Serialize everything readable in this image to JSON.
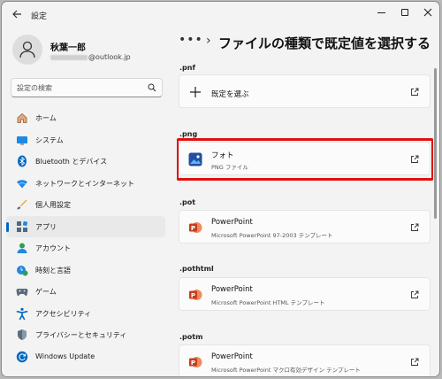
{
  "window": {
    "app_title": "設定"
  },
  "account": {
    "name": "秋葉一郎",
    "email_suffix": "@outlook.jp"
  },
  "search": {
    "placeholder": "設定の検索"
  },
  "sidebar": {
    "items": [
      {
        "label": "ホーム",
        "icon": "home-icon"
      },
      {
        "label": "システム",
        "icon": "system-icon"
      },
      {
        "label": "Bluetooth とデバイス",
        "icon": "bluetooth-icon"
      },
      {
        "label": "ネットワークとインターネット",
        "icon": "network-icon"
      },
      {
        "label": "個人用設定",
        "icon": "personalization-icon"
      },
      {
        "label": "アプリ",
        "icon": "apps-icon",
        "selected": true
      },
      {
        "label": "アカウント",
        "icon": "account-icon"
      },
      {
        "label": "時刻と言語",
        "icon": "time-language-icon"
      },
      {
        "label": "ゲーム",
        "icon": "gaming-icon"
      },
      {
        "label": "アクセシビリティ",
        "icon": "accessibility-icon"
      },
      {
        "label": "プライバシーとセキュリティ",
        "icon": "privacy-icon"
      },
      {
        "label": "Windows Update",
        "icon": "windows-update-icon"
      }
    ]
  },
  "header": {
    "breadcrumb_dots": "•••",
    "chevron": "›",
    "title": "ファイルの種類で既定値を選択する"
  },
  "main": {
    "sections": [
      {
        "ext": ".pnf",
        "app": "既定を選ぶ",
        "desc": "",
        "icon": "plus-icon"
      },
      {
        "ext": ".png",
        "app": "フォト",
        "desc": "PNG ファイル",
        "icon": "photos-icon",
        "highlighted": true
      },
      {
        "ext": ".pot",
        "app": "PowerPoint",
        "desc": "Microsoft PowerPoint 97-2003 テンプレート",
        "icon": "powerpoint-icon"
      },
      {
        "ext": ".pothtml",
        "app": "PowerPoint",
        "desc": "Microsoft PowerPoint HTML テンプレート",
        "icon": "powerpoint-icon"
      },
      {
        "ext": ".potm",
        "app": "PowerPoint",
        "desc": "Microsoft PowerPoint マクロ有効デザイン テンプレート",
        "icon": "powerpoint-icon"
      }
    ]
  },
  "colors": {
    "accent": "#0067c0",
    "highlight_border": "#e01010",
    "powerpoint": "#c43e1c"
  }
}
